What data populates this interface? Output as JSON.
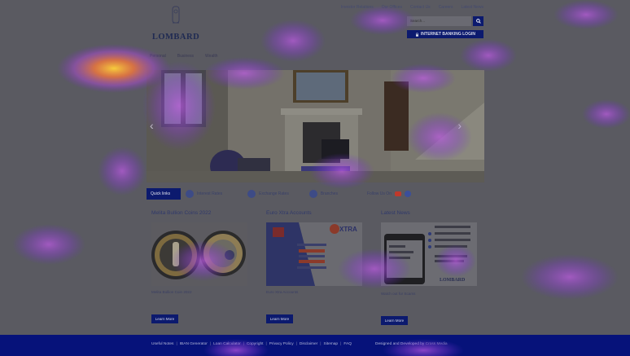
{
  "brand": {
    "name": "LOMBARD"
  },
  "top_links": [
    "Investor Relations",
    "Our Offices",
    "Contact Us",
    "Careers",
    "Latest News"
  ],
  "search": {
    "placeholder": "Search...",
    "icon": "search-icon"
  },
  "internet_banking": {
    "label": "INTERNET BANKING LOGIN",
    "icon": "lock-icon"
  },
  "main_nav": [
    "Personal",
    "Business",
    "Wealth"
  ],
  "quick_links": {
    "title": "Quick links",
    "items": [
      {
        "label": "Interest Rates",
        "icon": "percent-icon"
      },
      {
        "label": "Exchange Rates",
        "icon": "exchange-icon"
      },
      {
        "label": "Branches",
        "icon": "map-pin-icon"
      }
    ],
    "follow_label": "Follow Us On"
  },
  "columns": [
    {
      "title": "Melita Bullion Coins 2022",
      "caption": "Melita Bullion Coin 2022",
      "button": "Learn More"
    },
    {
      "title": "Euro Xtra Accounts",
      "caption": "Euro Xtra Accounts",
      "button": "Learn More",
      "ad": {
        "brand": "XTRA"
      }
    },
    {
      "title": "Latest News",
      "caption": "Watch out for Scams",
      "button": "Learn More",
      "news_heading": "Watch out for scams",
      "ad_brand": "LOMBARD"
    }
  ],
  "footer": {
    "links": [
      "Useful Notes",
      "IBAN Generator",
      "Loan Calculator",
      "Copyright",
      "Privacy Policy",
      "Disclaimer",
      "Sitemap",
      "FAQ"
    ],
    "credit": "Designed and Developed by",
    "credit_brand": "Cross Media"
  },
  "colors": {
    "navy": "#0c1a6e",
    "footer": "#06127a"
  }
}
